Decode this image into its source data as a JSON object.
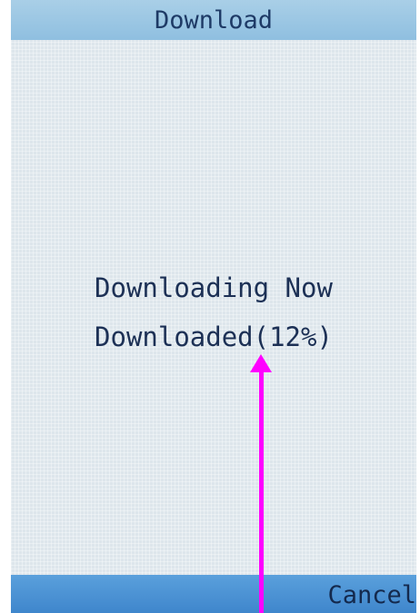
{
  "header": {
    "title": "Download"
  },
  "status": {
    "line1": "Downloading Now",
    "line2": "Downloaded(12%)",
    "progress_percent": 12
  },
  "softkeys": {
    "right": "Cancel"
  },
  "annotation": {
    "color": "#ff00ff"
  },
  "colors": {
    "title_bar": "#9ac6e4",
    "softkey_bar": "#4a92d4",
    "screen_bg": "#dde6ec",
    "text": "#1c3055"
  }
}
